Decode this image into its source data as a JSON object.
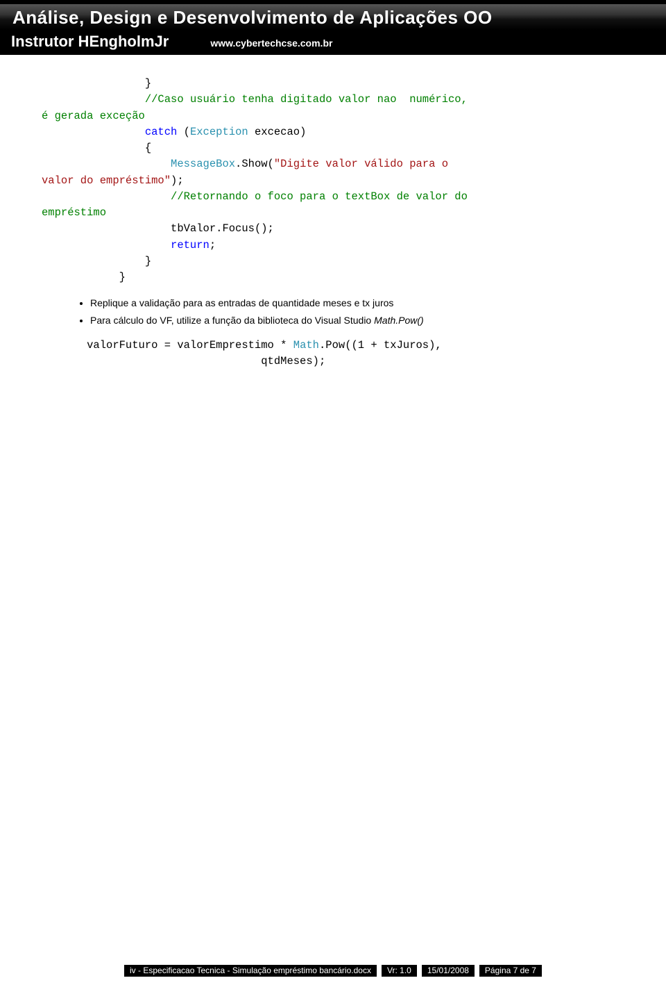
{
  "header": {
    "title": "Análise, Design e Desenvolvimento de Aplicações OO",
    "instructor": "Instrutor HEngholmJr",
    "url": "www.cybertechcse.com.br"
  },
  "code1": {
    "l1": "                }",
    "l2a": "                ",
    "l2b": "//Caso usuário tenha digitado valor nao  numérico, ",
    "l3": "é gerada exceção",
    "l4a": "                ",
    "l4b": "catch",
    "l4c": " (",
    "l4d": "Exception",
    "l4e": " excecao)",
    "l5": "                {",
    "l6a": "                    ",
    "l6b": "MessageBox",
    "l6c": ".Show(",
    "l6d": "\"Digite valor válido para o ",
    "l7a": "valor do empréstimo\"",
    "l7b": ");",
    "l8a": "                    ",
    "l8b": "//Retornando o foco para o textBox de valor do ",
    "l9": "empréstimo",
    "l10": "                    tbValor.Focus();",
    "l11a": "                    ",
    "l11b": "return",
    "l11c": ";",
    "l12": "                }",
    "l13": "            }"
  },
  "bullets": {
    "b1": "Replique a validação para as entradas de quantidade meses e tx juros",
    "b2a": "Para cálculo do VF, utilize a função da biblioteca do Visual Studio ",
    "b2b": "Math.Pow()"
  },
  "code2": {
    "l1a": "       valorFuturo = valorEmprestimo * ",
    "l1b": "Math",
    "l1c": ".Pow((1 + txJuros), ",
    "l2": "                                  qtdMeses);"
  },
  "footer": {
    "filename": "iv - Especificacao Tecnica - Simulação empréstimo bancário.docx",
    "version": "Vr: 1.0",
    "date": "15/01/2008",
    "page": "Página 7 de 7"
  }
}
